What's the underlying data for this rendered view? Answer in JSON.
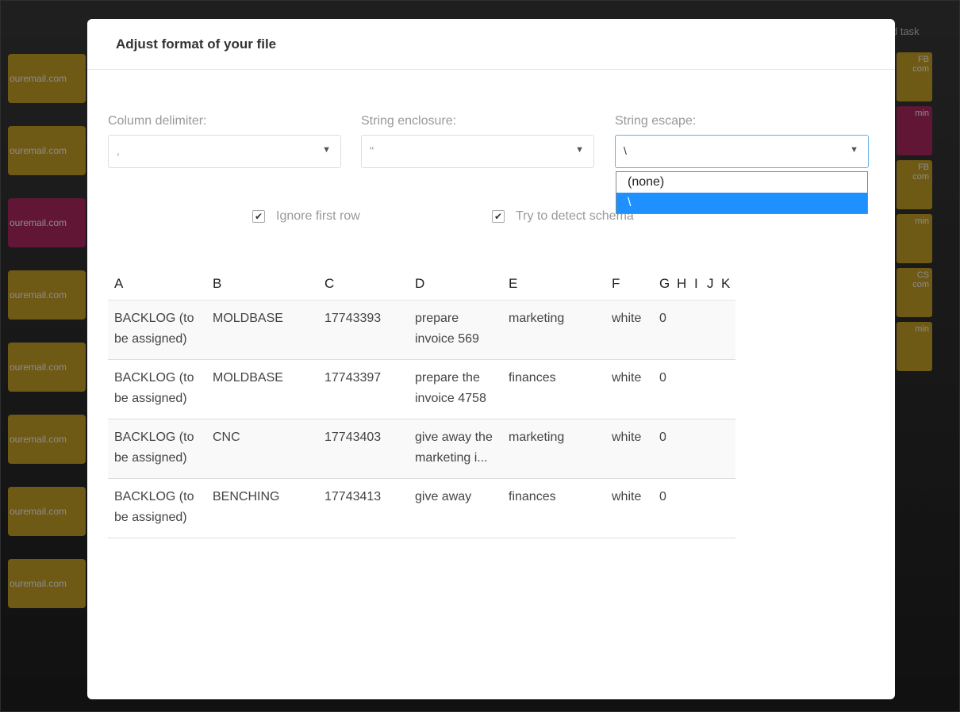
{
  "background": {
    "header_task": "d task",
    "left_cards": [
      {
        "text": "ouremail.com",
        "color": "yellow"
      },
      {
        "text": "ouremail.com",
        "color": "yellow"
      },
      {
        "text": "ouremail.com",
        "color": "magenta"
      },
      {
        "text": "ouremail.com",
        "color": "yellow"
      },
      {
        "text": "ouremail.com",
        "color": "yellow"
      },
      {
        "text": "ouremail.com",
        "color": "yellow"
      },
      {
        "text": "ouremail.com",
        "color": "yellow"
      },
      {
        "text": "ouremail.com",
        "color": "yellow"
      }
    ],
    "right_cards": [
      {
        "tag": "FB",
        "text": "com",
        "color": "yellow"
      },
      {
        "tag": "",
        "text": "min",
        "color": "magenta"
      },
      {
        "tag": "FB",
        "text": "com",
        "color": "yellow"
      },
      {
        "tag": "",
        "text": "min",
        "color": "yellow"
      },
      {
        "tag": "CS",
        "text": "com",
        "color": "yellow"
      },
      {
        "tag": "",
        "text": "min",
        "color": "yellow"
      }
    ]
  },
  "modal": {
    "title": "Adjust format of your file",
    "column_delimiter": {
      "label": "Column delimiter:",
      "value": ","
    },
    "string_enclosure": {
      "label": "String enclosure:",
      "value": "\""
    },
    "string_escape": {
      "label": "String escape:",
      "value": "\\"
    },
    "escape_options": [
      {
        "label": "(none)",
        "selected": false
      },
      {
        "label": "\\",
        "selected": true
      }
    ],
    "ignore_first_row": {
      "label": "Ignore first row",
      "checked": true
    },
    "detect_schema": {
      "label": "Try to detect schema",
      "checked": true
    },
    "preview": {
      "columns": [
        "A",
        "B",
        "C",
        "D",
        "E",
        "F",
        "G",
        "H",
        "I",
        "J",
        "K"
      ],
      "rows": [
        [
          "BACKLOG (to be assigned)",
          "MOLDBASE",
          "17743393",
          "prepare invoice 569",
          "marketing",
          "white",
          "0",
          "",
          "",
          "",
          ""
        ],
        [
          "BACKLOG (to be assigned)",
          "MOLDBASE",
          "17743397",
          "prepare the invoice 4758",
          "finances",
          "white",
          "0",
          "",
          "",
          "",
          ""
        ],
        [
          "BACKLOG (to be assigned)",
          "CNC",
          "17743403",
          "give away the marketing i...",
          "marketing",
          "white",
          "0",
          "",
          "",
          "",
          ""
        ],
        [
          "BACKLOG (to be assigned)",
          "BENCHING",
          "17743413",
          "give away",
          "finances",
          "white",
          "0",
          "",
          "",
          "",
          ""
        ]
      ]
    }
  }
}
